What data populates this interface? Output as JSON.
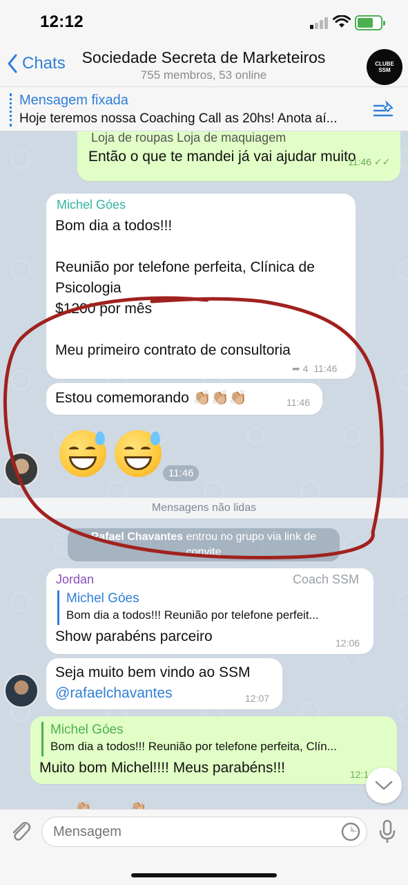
{
  "status_bar": {
    "time": "12:12"
  },
  "header": {
    "back_label": "Chats",
    "title": "Sociedade Secreta de Marketeiros",
    "subtitle": "755 membros, 53 online",
    "avatar_text_1": "CLUBE",
    "avatar_text_2": "SSM"
  },
  "pinned": {
    "label": "Mensagem fixada",
    "text": "Hoje teremos nossa Coaching Call as 20hs! Anota aí..."
  },
  "messages": {
    "top_out": {
      "partial_line": "Loja de roupas  Loja de maquiagem",
      "text": "Então o que te mandei já vai ajudar muito",
      "time": "11:46"
    },
    "michel_long": {
      "sender": "Michel Góes",
      "line1": "Bom dia a todos!!!",
      "line2": "Reunião por telefone perfeita, Clínica de",
      "line3": "Psicologia",
      "line4": "$1200 por mês",
      "line5": "Meu primeiro contrato de consultoria",
      "forwards": "4",
      "time": "11:46"
    },
    "michel_celebrate": {
      "text": "Estou comemorando 👏🏼👏🏼👏🏼",
      "time": "11:46"
    },
    "emoji_time": "11:46",
    "unread_label": "Mensagens não lidas",
    "service": {
      "name": "Rafael Chavantes",
      "text": "entrou no grupo via link de convite"
    },
    "jordan": {
      "sender": "Jordan",
      "role": "Coach SSM",
      "reply_name": "Michel Góes",
      "reply_text": "Bom dia a todos!!! Reunião por telefone perfeit...",
      "text": "Show parabéns parceiro",
      "time": "12:06"
    },
    "jordan_welcome": {
      "line1": "Seja muito bem vindo ao SSM",
      "mention": "@rafaelchavantes",
      "time": "12:07"
    },
    "out_reply": {
      "reply_name": "Michel Góes",
      "reply_text": "Bom dia a todos!!! Reunião por telefone perfeita, Clín...",
      "text": "Muito bom Michel!!!! Meus parabéns!!!",
      "time": "12:1"
    }
  },
  "input": {
    "placeholder": "Mensagem"
  },
  "colors": {
    "accent": "#2f7fd6",
    "outgoing": "#e1fec6",
    "annotation": "#a0221e"
  }
}
